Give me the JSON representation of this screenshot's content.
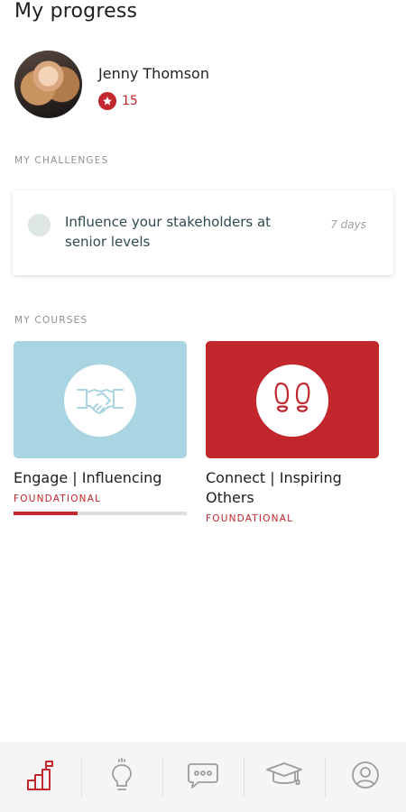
{
  "page": {
    "title": "My progress"
  },
  "profile": {
    "name": "Jenny Thomson",
    "points": "15"
  },
  "sections": {
    "challenges": "MY CHALLENGES",
    "courses": "MY COURSES"
  },
  "challenge": {
    "text": "Influence your stakeholders at senior levels",
    "duration": "7 days"
  },
  "courses": [
    {
      "title": "Engage | Influencing",
      "level": "FOUNDATIONAL",
      "icon": "handshake-icon",
      "color": "#a9d4e2",
      "progress": 0.37
    },
    {
      "title": "Connect | Inspiring Others",
      "level": "FOUNDATIONAL",
      "icon": "footprints-icon",
      "color": "#c1272d"
    }
  ],
  "nav": [
    {
      "icon": "progress-icon",
      "active": true
    },
    {
      "icon": "lightbulb-icon"
    },
    {
      "icon": "chat-icon"
    },
    {
      "icon": "graduation-cap-icon"
    },
    {
      "icon": "profile-icon"
    }
  ],
  "colors": {
    "accent": "#c1272d",
    "inactive_icon": "#9c9c9c",
    "tile_blue": "#a9d4e2"
  }
}
